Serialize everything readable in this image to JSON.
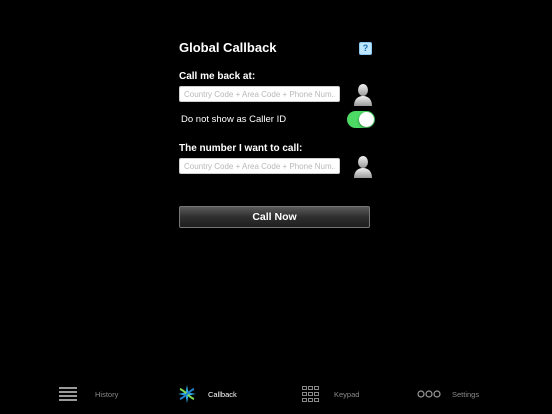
{
  "header": {
    "title": "Global Callback",
    "help_icon": "question-icon",
    "help_text": "?"
  },
  "callback": {
    "label": "Call me back at:",
    "placeholder": "Country Code + Area Code + Phone Num...",
    "value": "",
    "contact_icon": "contact-person-icon"
  },
  "caller_id": {
    "label": "Do not show as Caller ID",
    "enabled": true,
    "on_color": "#4cd964"
  },
  "target": {
    "label": "The number I want to call:",
    "placeholder": "Country Code + Area Code + Phone Num...",
    "value": "",
    "contact_icon": "contact-person-icon"
  },
  "call_button": {
    "label": "Call Now"
  },
  "tabbar": {
    "active": "Callback",
    "items": [
      {
        "label": "History",
        "icon": "list-icon"
      },
      {
        "label": "Callback",
        "icon": "callback-icon"
      },
      {
        "label": "Keypad",
        "icon": "keypad-grid-icon"
      },
      {
        "label": "Settings",
        "icon": "more-dots-icon"
      }
    ]
  }
}
